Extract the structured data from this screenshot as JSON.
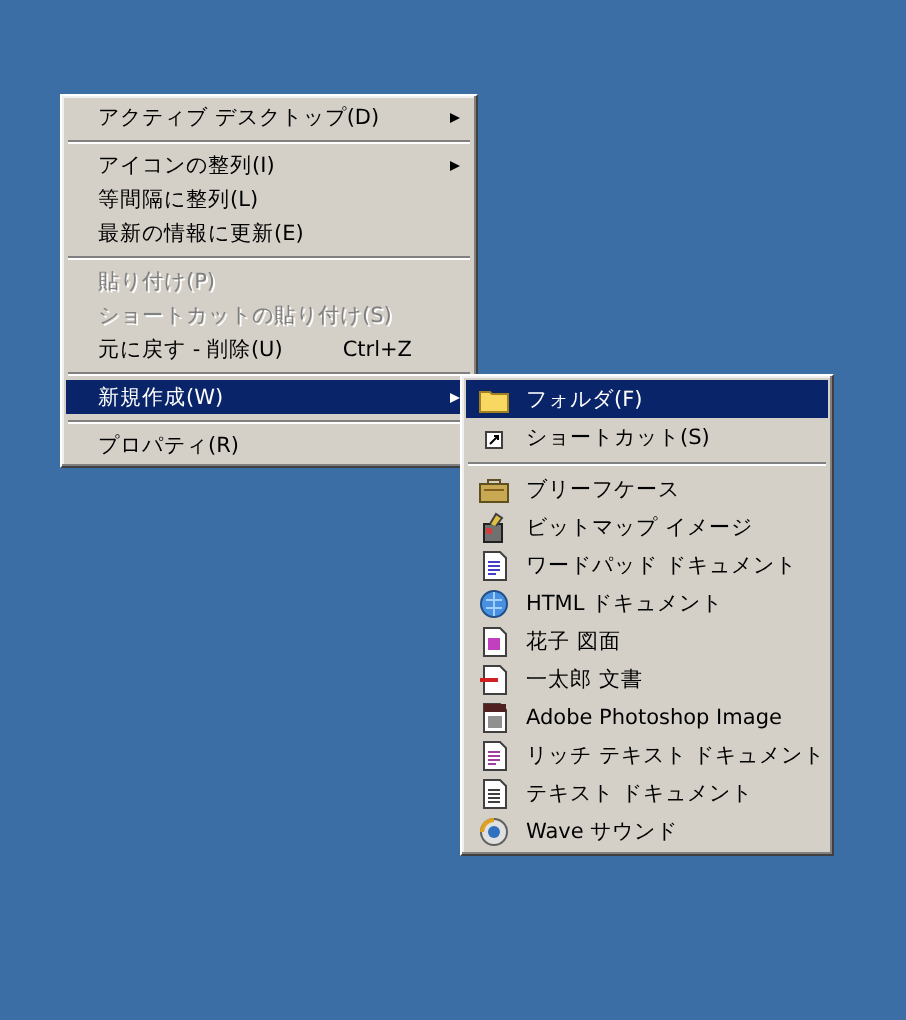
{
  "context_menu": {
    "items": [
      {
        "kind": "item",
        "label": "アクティブ デスクトップ(D)",
        "has_submenu": true,
        "disabled": false,
        "selected": false
      },
      {
        "kind": "separator"
      },
      {
        "kind": "item",
        "label": "アイコンの整列(I)",
        "has_submenu": true,
        "disabled": false,
        "selected": false
      },
      {
        "kind": "item",
        "label": "等間隔に整列(L)",
        "has_submenu": false,
        "disabled": false,
        "selected": false
      },
      {
        "kind": "item",
        "label": "最新の情報に更新(E)",
        "has_submenu": false,
        "disabled": false,
        "selected": false
      },
      {
        "kind": "separator"
      },
      {
        "kind": "item",
        "label": "貼り付け(P)",
        "has_submenu": false,
        "disabled": true,
        "selected": false
      },
      {
        "kind": "item",
        "label": "ショートカットの貼り付け(S)",
        "has_submenu": false,
        "disabled": true,
        "selected": false
      },
      {
        "kind": "item",
        "label": "元に戻す - 削除(U)",
        "shortcut": "Ctrl+Z",
        "has_submenu": false,
        "disabled": false,
        "selected": false
      },
      {
        "kind": "separator"
      },
      {
        "kind": "item",
        "label": "新規作成(W)",
        "has_submenu": true,
        "disabled": false,
        "selected": true
      },
      {
        "kind": "separator"
      },
      {
        "kind": "item",
        "label": "プロパティ(R)",
        "has_submenu": false,
        "disabled": false,
        "selected": false
      }
    ]
  },
  "new_submenu": {
    "items": [
      {
        "kind": "item",
        "label": "フォルダ(F)",
        "selected": true
      },
      {
        "kind": "item",
        "label": "ショートカット(S)",
        "selected": false
      },
      {
        "kind": "separator"
      },
      {
        "kind": "item",
        "label": "ブリーフケース",
        "selected": false
      },
      {
        "kind": "item",
        "label": "ビットマップ イメージ",
        "selected": false
      },
      {
        "kind": "item",
        "label": "ワードパッド ドキュメント",
        "selected": false
      },
      {
        "kind": "item",
        "label": "HTML ドキュメント",
        "selected": false
      },
      {
        "kind": "item",
        "label": "花子 図面",
        "selected": false
      },
      {
        "kind": "item",
        "label": "一太郎 文書",
        "selected": false
      },
      {
        "kind": "item",
        "label": "Adobe Photoshop Image",
        "selected": false
      },
      {
        "kind": "item",
        "label": "リッチ テキスト ドキュメント",
        "selected": false
      },
      {
        "kind": "item",
        "label": "テキスト ドキュメント",
        "selected": false
      },
      {
        "kind": "item",
        "label": "Wave サウンド",
        "selected": false
      }
    ]
  }
}
